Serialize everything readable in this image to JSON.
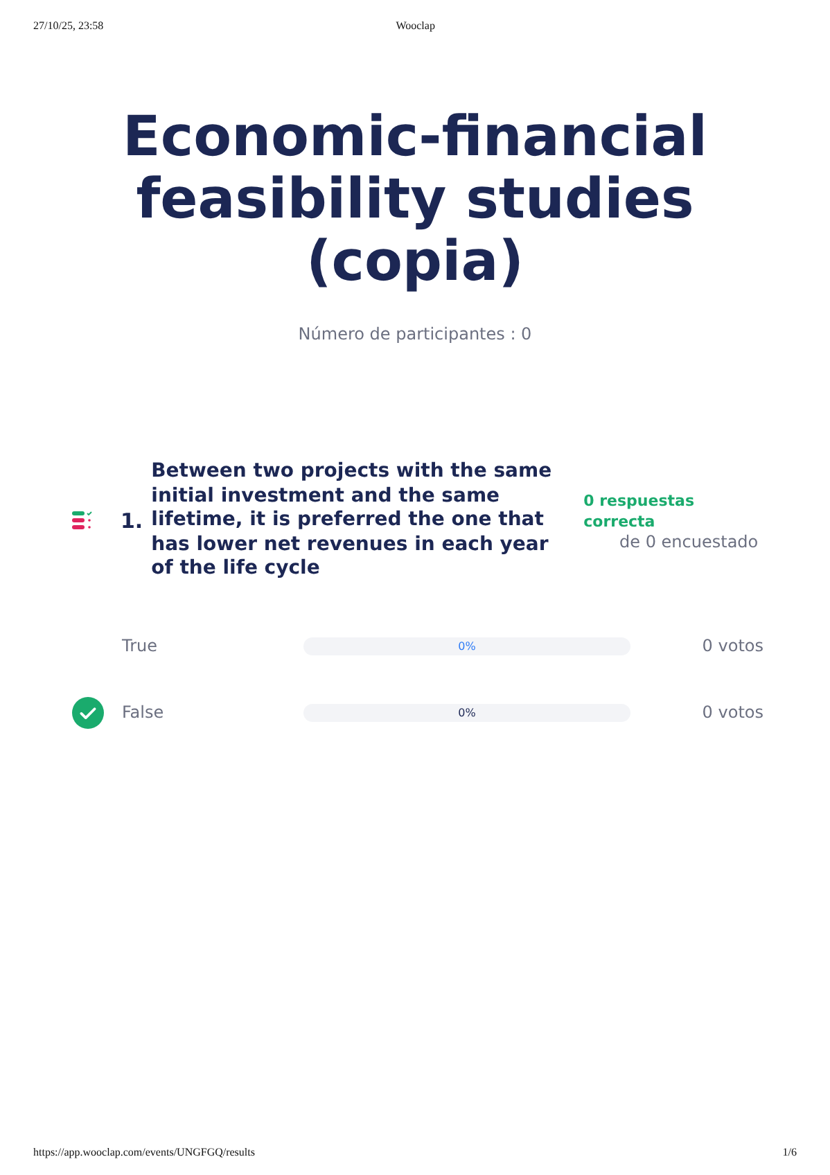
{
  "header": {
    "datetime": "27/10/25, 23:58",
    "site": "Wooclap"
  },
  "title": "Economic-financial feasibility studies (copia)",
  "participants": "Número de participantes : 0",
  "question": {
    "number": "1.",
    "text": "Between two projects with the same initial investment and the same lifetime, it is preferred the one that has lower net revenues in each year of the life cycle",
    "correct_count": "0 respuestas correcta",
    "respondents": "de 0 encuestado"
  },
  "options": [
    {
      "label": "True",
      "correct": false,
      "percent": "0%",
      "votes": "0 votos"
    },
    {
      "label": "False",
      "correct": true,
      "percent": "0%",
      "votes": "0 votos"
    }
  ],
  "footer": {
    "url": "https://app.wooclap.com/events/UNGFGQ/results",
    "page": "1/6"
  }
}
